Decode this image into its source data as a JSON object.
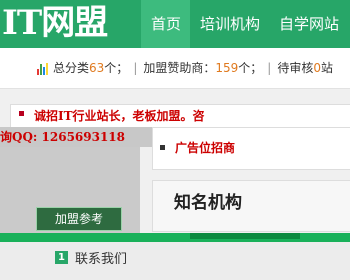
{
  "header": {
    "logo_text": "IT网盟",
    "nav": [
      {
        "label": "首页",
        "active": true
      },
      {
        "label": "培训机构",
        "active": false
      },
      {
        "label": "自学网站",
        "active": false
      }
    ]
  },
  "stats": {
    "total_label": "总分类",
    "total_value": "63",
    "total_unit": "个；",
    "separator": "|",
    "sponsor_label": "加盟赞助商：",
    "sponsor_value": "159",
    "sponsor_unit": "个；",
    "pending_label": "待审核",
    "pending_value": "0",
    "pending_unit": "站"
  },
  "notice": {
    "text": "诚招IT行业站长，老板加盟。咨"
  },
  "contact_qq": {
    "text": "询QQ: 1265693118"
  },
  "join_button": {
    "label": "加盟参考"
  },
  "ad_box": {
    "text": "广告位招商"
  },
  "org_box": {
    "title": "知名机构"
  },
  "footer": {
    "contact_badge": "1",
    "contact_label": "联系我们"
  },
  "colors": {
    "brand_green": "#27a668",
    "nav_active": "#3dbb7e",
    "highlight_red": "#cc0000",
    "number_orange": "#e07a1f"
  }
}
